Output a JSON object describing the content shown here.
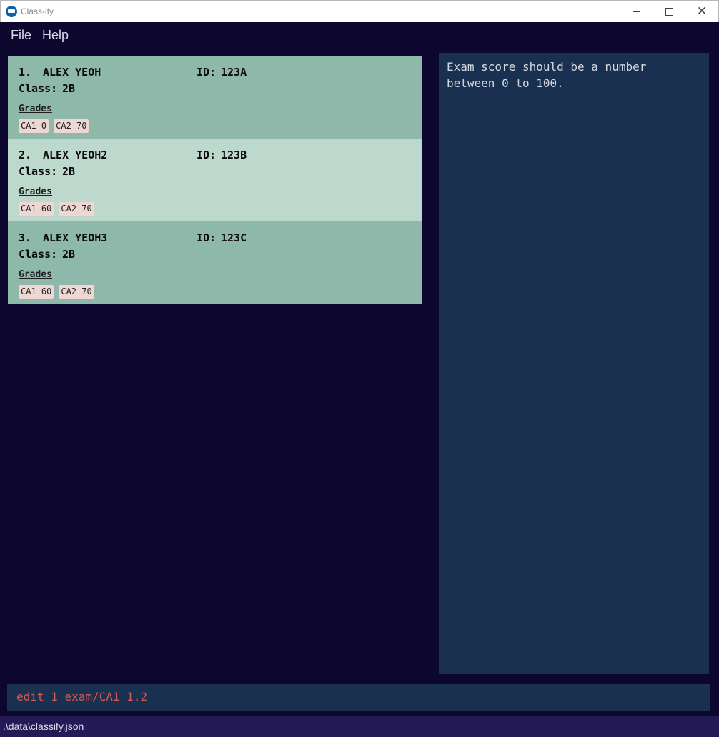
{
  "window": {
    "title": "Class-ify",
    "close_glyph": "✕"
  },
  "menu": {
    "file": "File",
    "help": "Help"
  },
  "students": [
    {
      "index": "1.",
      "name": "ALEX YEOH",
      "id_label": "ID:",
      "id": "123A",
      "class_label": "Class:",
      "class": "2B",
      "grades_heading": "Grades",
      "grades": [
        "CA1 0",
        "CA2 70"
      ],
      "selected": false
    },
    {
      "index": "2.",
      "name": "ALEX YEOH2",
      "id_label": "ID:",
      "id": "123B",
      "class_label": "Class:",
      "class": "2B",
      "grades_heading": "Grades",
      "grades": [
        "CA1 60",
        "CA2 70"
      ],
      "selected": true
    },
    {
      "index": "3.",
      "name": "ALEX YEOH3",
      "id_label": "ID:",
      "id": "123C",
      "class_label": "Class:",
      "class": "2B",
      "grades_heading": "Grades",
      "grades": [
        "CA1 60",
        "CA2 70"
      ],
      "selected": false
    }
  ],
  "result": {
    "message": "Exam score should be a number\nbetween 0 to 100."
  },
  "command": {
    "value": "edit 1 exam/CA1 1.2"
  },
  "status": {
    "file_path": ".\\data\\classify.json"
  },
  "colors": {
    "background": "#0d0730",
    "card": "#8db8aa",
    "card_selected": "#bdd9ce",
    "grade_tag": "#eed7d3",
    "panel": "#1a3050",
    "command_text": "#d45a52",
    "statusbar": "#241a55"
  },
  "icons": {
    "app": "graduation-cap-icon",
    "minimize": "minimize-icon",
    "maximize": "maximize-icon",
    "close": "close-icon"
  }
}
